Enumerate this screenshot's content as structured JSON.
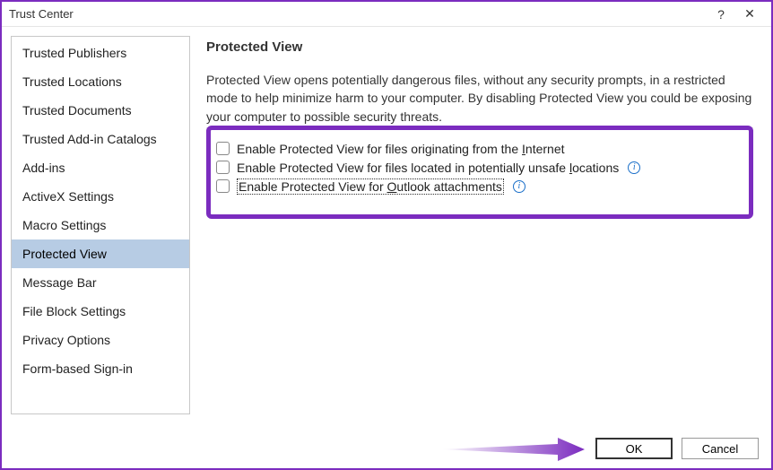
{
  "window": {
    "title": "Trust Center",
    "help_glyph": "?",
    "close_glyph": "✕"
  },
  "sidebar": {
    "items": [
      {
        "label": "Trusted Publishers"
      },
      {
        "label": "Trusted Locations"
      },
      {
        "label": "Trusted Documents"
      },
      {
        "label": "Trusted Add-in Catalogs"
      },
      {
        "label": "Add-ins"
      },
      {
        "label": "ActiveX Settings"
      },
      {
        "label": "Macro Settings"
      },
      {
        "label": "Protected View"
      },
      {
        "label": "Message Bar"
      },
      {
        "label": "File Block Settings"
      },
      {
        "label": "Privacy Options"
      },
      {
        "label": "Form-based Sign-in"
      }
    ],
    "selected_index": 7
  },
  "main": {
    "section_title": "Protected View",
    "description": "Protected View opens potentially dangerous files, without any security prompts, in a restricted mode to help minimize harm to your computer. By disabling Protected View you could be exposing your computer to possible security threats.",
    "checkboxes": [
      {
        "pre": "Enable Protected View for files originating from the ",
        "u": "I",
        "post": "nternet",
        "info": false,
        "focused": false
      },
      {
        "pre": "Enable Protected View for files located in potentially unsafe ",
        "u": "l",
        "post": "ocations",
        "info": true,
        "focused": false
      },
      {
        "pre": "Enable Protected View for ",
        "u": "O",
        "post": "utlook attachments",
        "info": true,
        "focused": true
      }
    ]
  },
  "footer": {
    "ok": "OK",
    "cancel": "Cancel"
  },
  "annotations": {
    "highlight_border_color": "#7b2cbf",
    "arrow_color": "#7b2cbf"
  }
}
